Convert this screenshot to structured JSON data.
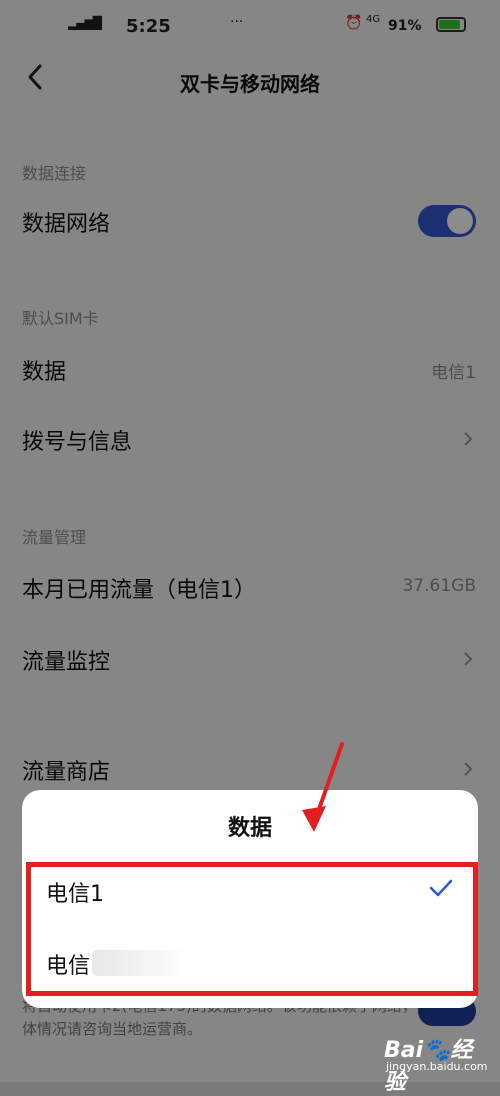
{
  "status": {
    "signal": "▂▄▆█",
    "time": "5:25",
    "dots": "···",
    "network": "4G",
    "battery": "91%"
  },
  "header": {
    "title": "双卡与移动网络"
  },
  "sections": {
    "data_connection": "数据连接",
    "default_sim": "默认SIM卡",
    "traffic_management": "流量管理"
  },
  "rows": {
    "mobile_data": {
      "label": "数据网络",
      "enabled": true
    },
    "data": {
      "label": "数据",
      "value": "电信1"
    },
    "dial_messages": {
      "label": "拨号与信息"
    },
    "monthly_usage": {
      "label": "本月已用流量（电信1）",
      "value": "37.61GB"
    },
    "traffic_monitor": {
      "label": "流量监控"
    },
    "traffic_store": {
      "label": "流量商店"
    }
  },
  "footer_note": "将自动使用卡2(电信173)的数据网络。该功能依赖于网络，具体情况请咨询当地运营商。",
  "dialog": {
    "title": "数据",
    "options": [
      {
        "label": "电信1",
        "selected": true
      },
      {
        "label": "电信",
        "selected": false
      }
    ]
  },
  "watermark": {
    "brand": "Bai🐾经验",
    "sub": "jingyan.baidu.com"
  },
  "colors": {
    "accent": "#3456d2",
    "highlight": "#e31e1e"
  }
}
